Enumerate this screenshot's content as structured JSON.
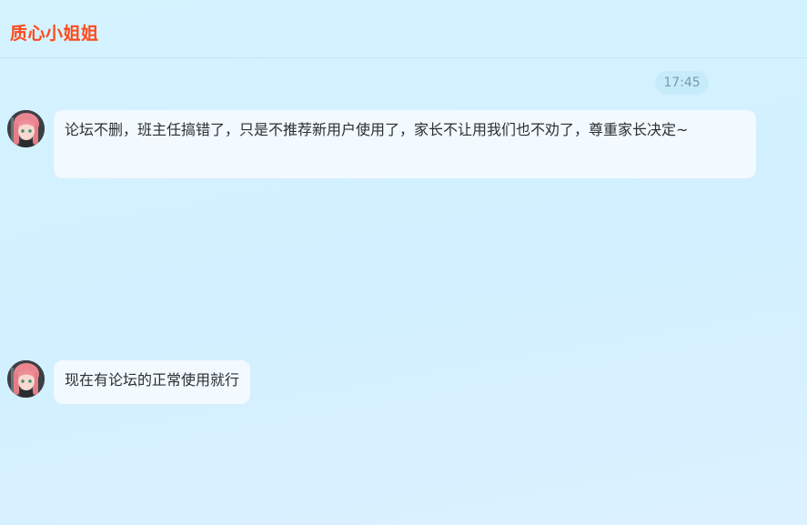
{
  "header": {
    "contact_name": "质心小姐姐"
  },
  "timestamp": "17:45",
  "messages": [
    {
      "text": "论坛不删，班主任搞错了，只是不推荐新用户使用了，家长不让用我们也不劝了，尊重家长决定~"
    },
    {
      "text": "现在有论坛的正常使用就行"
    }
  ],
  "colors": {
    "accent": "#ff4a1c",
    "bubble": "#f2f9ff",
    "background": "#d4f3ff"
  },
  "icons": {
    "avatar": "pink-hair-anime-girl-avatar"
  }
}
